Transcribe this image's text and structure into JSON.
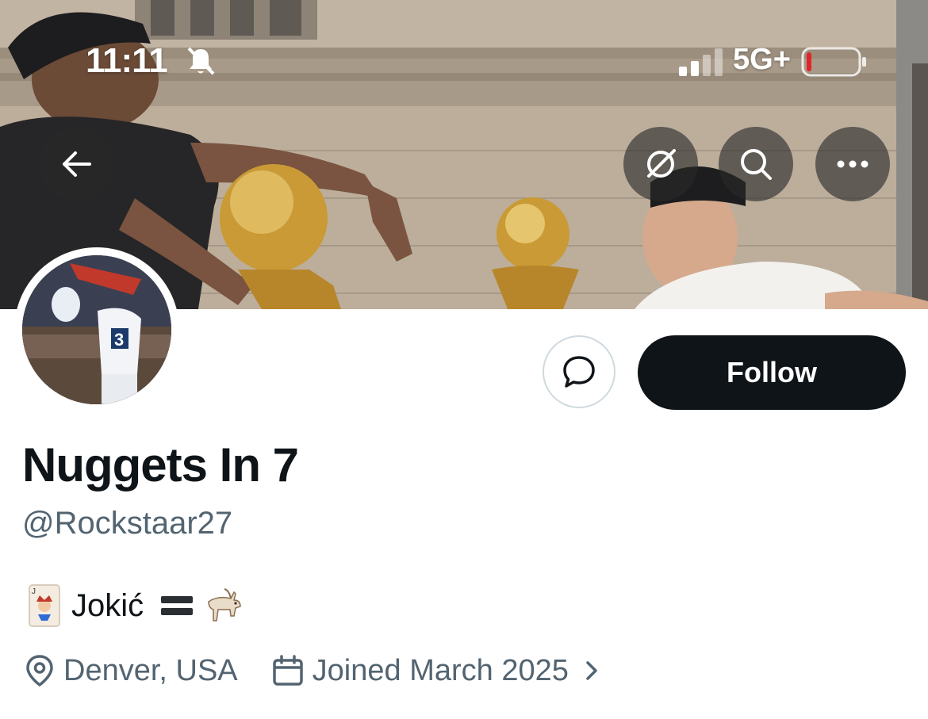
{
  "status_bar": {
    "time": "11:11",
    "network": "5G+",
    "bell_icon": "bell-slash-icon",
    "battery_level": 0.1
  },
  "header_actions": {
    "back_icon": "arrow-left-icon",
    "grok_icon": "grok-icon",
    "search_icon": "search-icon",
    "more_icon": "more-horizontal-icon"
  },
  "profile": {
    "display_name": "Nuggets In 7",
    "handle": "@Rockstaar27",
    "bio_text": "Jokić",
    "location": "Denver, USA",
    "joined": "Joined March 2025"
  },
  "buttons": {
    "follow_label": "Follow",
    "message_icon": "message-bubble-icon"
  },
  "colors": {
    "primary_text": "#0f1419",
    "secondary_text": "#536471",
    "follow_bg": "#0f1419",
    "border": "#cfd9de",
    "battery_low": "#e0252a"
  }
}
